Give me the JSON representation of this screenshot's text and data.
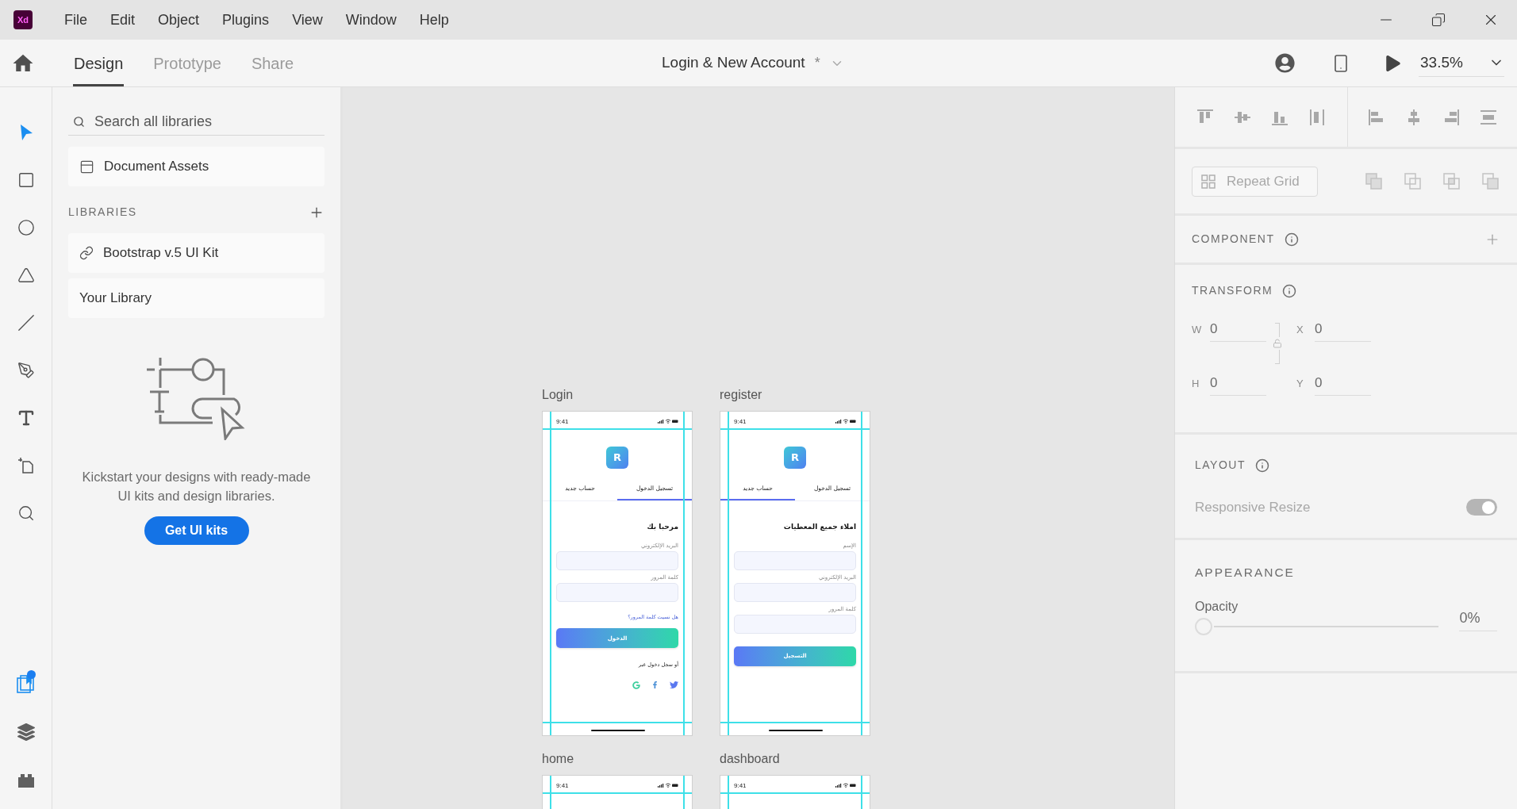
{
  "menu_bar": {
    "logo": "Xd",
    "items": [
      "File",
      "Edit",
      "Object",
      "Plugins",
      "View",
      "Window",
      "Help"
    ]
  },
  "toolbar": {
    "tabs": [
      {
        "label": "Design",
        "selected": true
      },
      {
        "label": "Prototype",
        "selected": false
      },
      {
        "label": "Share",
        "selected": false
      }
    ],
    "document_title": "Login & New Account",
    "unsaved_mark": "*",
    "zoom": "33.5%"
  },
  "tools": [
    {
      "kind": "select",
      "selected": true
    },
    {
      "kind": "rectangle",
      "selected": false
    },
    {
      "kind": "ellipse",
      "selected": false
    },
    {
      "kind": "polygon",
      "selected": false
    },
    {
      "kind": "line",
      "selected": false
    },
    {
      "kind": "pen",
      "selected": false
    },
    {
      "kind": "text",
      "selected": false
    },
    {
      "kind": "artboard",
      "selected": false
    },
    {
      "kind": "zoom",
      "selected": false
    }
  ],
  "panels": [
    {
      "kind": "libraries",
      "selected": true,
      "notification": true
    },
    {
      "kind": "layers",
      "selected": false,
      "notification": false
    },
    {
      "kind": "plugins",
      "selected": false,
      "notification": false
    }
  ],
  "libraries_panel": {
    "search": {
      "placeholder": "Search all libraries"
    },
    "document_assets": "Document Assets",
    "section_title": "LIBRARIES",
    "libraries": [
      {
        "label": "Bootstrap v.5 UI Kit",
        "linked": true
      },
      {
        "label": "Your Library",
        "linked": false
      }
    ],
    "promo": {
      "text": "Kickstart your designs with ready-made UI kits and design libraries.",
      "button": "Get UI kits"
    }
  },
  "artboards": [
    {
      "name": "Login",
      "time": "9:41",
      "screen": {
        "logo": "R",
        "tabs": [
          {
            "label": "تسجيل الدخول",
            "selected": true
          },
          {
            "label": "حساب جديد",
            "selected": false
          }
        ],
        "heading": "مرحبا بك",
        "fields": [
          {
            "label": "البريد الإلكتروني"
          },
          {
            "label": "كلمة المرور"
          }
        ],
        "link": "هل نسيت كلمة المرور؟",
        "button": "الدخول",
        "social": {
          "label": "أو سجل دخول عبر"
        }
      }
    },
    {
      "name": "register",
      "time": "9:41",
      "screen": {
        "logo": "R",
        "tabs": [
          {
            "label": "تسجيل الدخول",
            "selected": false
          },
          {
            "label": "حساب جديد",
            "selected": true
          }
        ],
        "heading": "املاء جميع المعطيات",
        "fields": [
          {
            "label": "الإسم"
          },
          {
            "label": "البريد الإلكتروني"
          },
          {
            "label": "كلمة المرور"
          }
        ],
        "button": "التسجيل"
      }
    },
    {
      "name": "home",
      "time": "9:41"
    },
    {
      "name": "dashboard",
      "time": "9:41"
    }
  ],
  "properties": {
    "repeat_grid": "Repeat Grid",
    "component": {
      "title": "COMPONENT"
    },
    "transform": {
      "title": "TRANSFORM",
      "fields": [
        {
          "label": "W",
          "value": "0"
        },
        {
          "label": "X",
          "value": "0"
        },
        {
          "label": "H",
          "value": "0"
        },
        {
          "label": "Y",
          "value": "0"
        }
      ]
    },
    "layout": {
      "title": "LAYOUT",
      "responsive_resize": {
        "label": "Responsive Resize",
        "on": true
      }
    },
    "appearance": {
      "title": "APPEARANCE",
      "opacity": {
        "label": "Opacity",
        "level": 0,
        "reading": "0%"
      }
    }
  }
}
